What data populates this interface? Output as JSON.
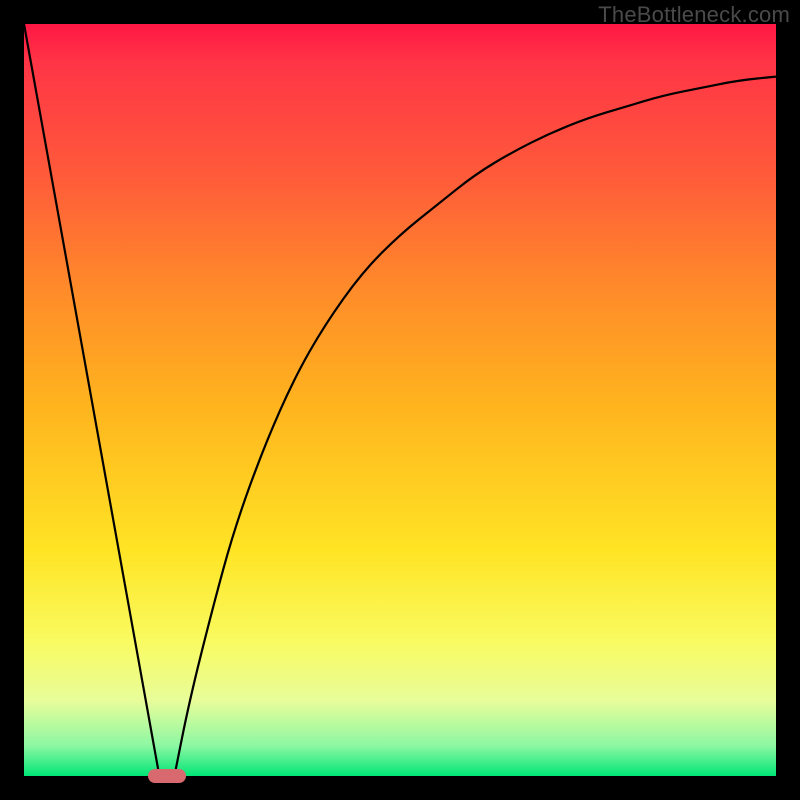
{
  "watermark": "TheBottleneck.com",
  "chart_data": {
    "type": "line",
    "title": "",
    "xlabel": "",
    "ylabel": "",
    "xlim": [
      0,
      100
    ],
    "ylim": [
      0,
      100
    ],
    "grid": false,
    "legend": false,
    "series": [
      {
        "name": "left-line",
        "x": [
          0,
          18
        ],
        "values": [
          100,
          0
        ]
      },
      {
        "name": "right-curve",
        "x": [
          20,
          22,
          25,
          28,
          32,
          36,
          40,
          45,
          50,
          55,
          60,
          65,
          70,
          75,
          80,
          85,
          90,
          95,
          100
        ],
        "values": [
          0,
          10,
          22,
          33,
          44,
          53,
          60,
          67,
          72,
          76,
          80,
          83,
          85.5,
          87.5,
          89,
          90.5,
          91.5,
          92.5,
          93
        ]
      }
    ],
    "marker": {
      "name": "optimal-point",
      "x": 19,
      "y": 0,
      "width_pct": 5,
      "color": "#d86a6f"
    },
    "background_gradient": {
      "top": "#ff1744",
      "mid": "#ffe424",
      "bottom": "#00e676"
    }
  }
}
